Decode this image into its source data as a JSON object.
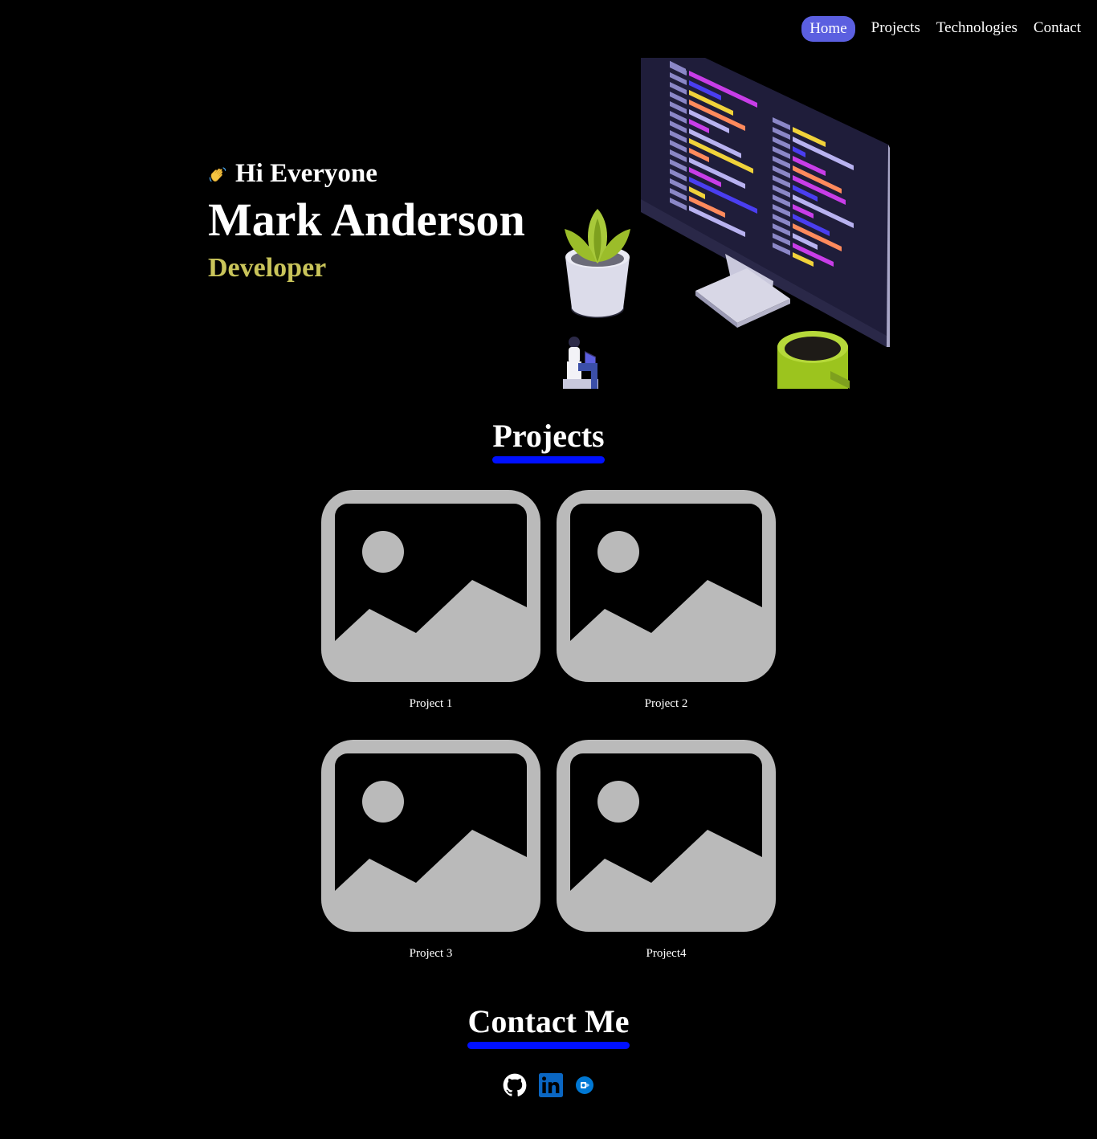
{
  "nav": {
    "items": [
      {
        "label": "Home",
        "active": true
      },
      {
        "label": "Projects",
        "active": false
      },
      {
        "label": "Technologies",
        "active": false
      },
      {
        "label": "Contact",
        "active": false
      }
    ]
  },
  "hero": {
    "greeting": "Hi Everyone",
    "name": "Mark Anderson",
    "role": "Developer"
  },
  "projects": {
    "title": "Projects",
    "items": [
      {
        "label": "Project 1"
      },
      {
        "label": "Project 2"
      },
      {
        "label": "Project 3"
      },
      {
        "label": "Project4"
      }
    ]
  },
  "contact": {
    "title": "Contact Me",
    "icons": [
      "github-icon",
      "linkedin-icon",
      "outlook-icon"
    ]
  },
  "colors": {
    "background": "#000000",
    "nav_active": "#5b5fe0",
    "role": "#c9c45a",
    "underline": "#0010ff",
    "placeholder": "#bababa"
  }
}
